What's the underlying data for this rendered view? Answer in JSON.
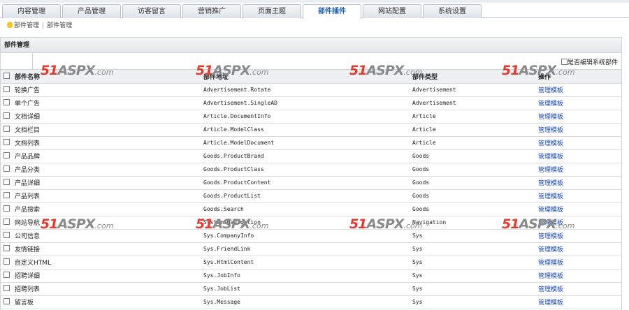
{
  "tabs": [
    "内容管理",
    "产品管理",
    "访客留言",
    "营销推广",
    "页面主题",
    "部件插件",
    "网站配置",
    "系统设置"
  ],
  "active_tab": "部件插件",
  "breadcrumb": {
    "first": "部件管理",
    "separator": "|",
    "second": "部件管理"
  },
  "panel": {
    "title": "部件管理",
    "system_edit_label": "是否编辑系统部件"
  },
  "table": {
    "headers": {
      "name": "部件名称",
      "address": "部件地址",
      "type": "部件类型",
      "action": "操作"
    },
    "rows": [
      {
        "name": "轮换广告",
        "address": "Advertisement.Rotate",
        "type": "Advertisement",
        "action": "管理模板"
      },
      {
        "name": "单个广告",
        "address": "Advertisement.SingleAD",
        "type": "Advertisement",
        "action": "管理模板"
      },
      {
        "name": "文档详细",
        "address": "Article.DocumentInfo",
        "type": "Article",
        "action": "管理模板"
      },
      {
        "name": "文档栏目",
        "address": "Article.ModelClass",
        "type": "Article",
        "action": "管理模板"
      },
      {
        "name": "文档列表",
        "address": "Article.ModelDocument",
        "type": "Article",
        "action": "管理模板"
      },
      {
        "name": "产品品牌",
        "address": "Goods.ProductBrand",
        "type": "Goods",
        "action": "管理模板"
      },
      {
        "name": "产品分类",
        "address": "Goods.ProductClass",
        "type": "Goods",
        "action": "管理模板"
      },
      {
        "name": "产品详细",
        "address": "Goods.ProductContent",
        "type": "Goods",
        "action": "管理模板"
      },
      {
        "name": "产品列表",
        "address": "Goods.ProductList",
        "type": "Goods",
        "action": "管理模板"
      },
      {
        "name": "产品搜索",
        "address": "Goods.Search",
        "type": "Goods",
        "action": "管理模板"
      },
      {
        "name": "网站导航",
        "address": "System.Navigation",
        "type": "Navigation",
        "action": "管理模板"
      },
      {
        "name": "公司信息",
        "address": "Sys.CompanyInfo",
        "type": "Sys",
        "action": "管理模板"
      },
      {
        "name": "友情链接",
        "address": "Sys.FriendLink",
        "type": "Sys",
        "action": "管理模板"
      },
      {
        "name": "自定义HTML",
        "address": "Sys.HtmlContent",
        "type": "Sys",
        "action": "管理模板"
      },
      {
        "name": "招聘详细",
        "address": "Sys.JobInfo",
        "type": "Sys",
        "action": "管理模板"
      },
      {
        "name": "招聘列表",
        "address": "Sys.JobList",
        "type": "Sys",
        "action": "管理模板"
      },
      {
        "name": "留言板",
        "address": "Sys.Message",
        "type": "Sys",
        "action": "管理模板"
      }
    ]
  },
  "watermark": {
    "number": "51",
    "brand": "ASPX",
    "suffix": ".com"
  },
  "colors": {
    "tab_active_text": "#1b63b8",
    "link": "#1847b8",
    "watermark_red": "#e8372b",
    "watermark_gray": "#8a8a8a"
  },
  "icons": {
    "breadcrumb_icon": "lightbulb-icon"
  }
}
